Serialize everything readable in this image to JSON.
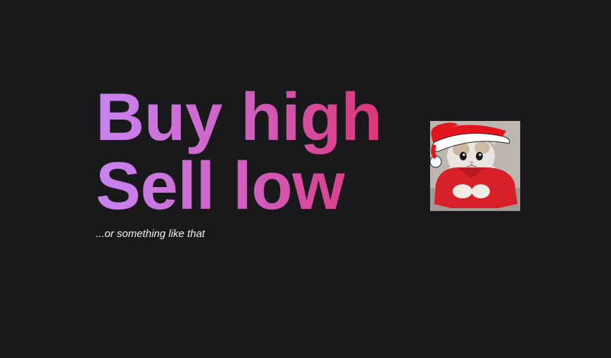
{
  "hero": {
    "line1": "Buy high",
    "line2": "Sell low",
    "tagline": "...or something like that",
    "gradient_colors": [
      "#c884f2",
      "#cf5fbf",
      "#e0306f"
    ]
  },
  "image": {
    "subject": "cat-in-santa-hat-icon"
  },
  "colors": {
    "background": "#19181b",
    "tagline": "#f2f2f2"
  }
}
